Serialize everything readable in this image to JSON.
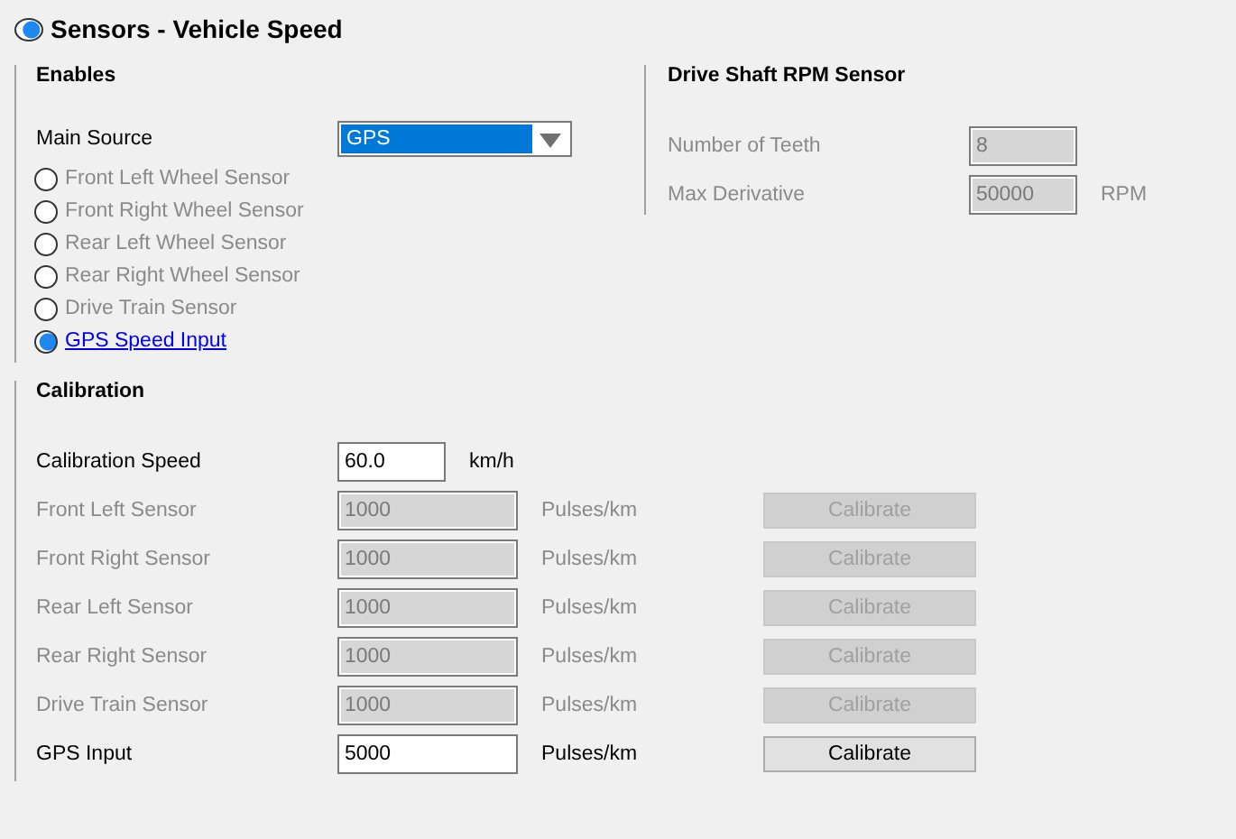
{
  "header": {
    "title": "Sensors - Vehicle Speed",
    "on": true
  },
  "enables": {
    "title": "Enables",
    "main_source": {
      "label": "Main Source",
      "value": "GPS"
    },
    "sources": [
      {
        "label": "Front Left Wheel Sensor",
        "selected": false,
        "disabled": true
      },
      {
        "label": "Front Right Wheel Sensor",
        "selected": false,
        "disabled": true
      },
      {
        "label": "Rear Left Wheel Sensor",
        "selected": false,
        "disabled": true
      },
      {
        "label": "Rear Right Wheel Sensor",
        "selected": false,
        "disabled": true
      },
      {
        "label": "Drive Train Sensor",
        "selected": false,
        "disabled": true
      },
      {
        "label": "GPS Speed Input",
        "selected": true,
        "disabled": false
      }
    ]
  },
  "drive_shaft": {
    "title": "Drive Shaft RPM Sensor",
    "fields": [
      {
        "label": "Number of Teeth",
        "value": "8",
        "disabled": true
      },
      {
        "label": "Max Derivative",
        "value": "50000",
        "unit": "RPM",
        "disabled": true
      }
    ]
  },
  "calibration": {
    "title": "Calibration",
    "speed": {
      "label": "Calibration Speed",
      "value": "60.0",
      "unit": "km/h"
    },
    "rows": [
      {
        "label": "Front Left Sensor",
        "value": "1000",
        "unit": "Pulses/km",
        "button": "Calibrate",
        "disabled": true
      },
      {
        "label": "Front Right Sensor",
        "value": "1000",
        "unit": "Pulses/km",
        "button": "Calibrate",
        "disabled": true
      },
      {
        "label": "Rear Left Sensor",
        "value": "1000",
        "unit": "Pulses/km",
        "button": "Calibrate",
        "disabled": true
      },
      {
        "label": "Rear Right Sensor",
        "value": "1000",
        "unit": "Pulses/km",
        "button": "Calibrate",
        "disabled": true
      },
      {
        "label": "Drive Train Sensor",
        "value": "1000",
        "unit": "Pulses/km",
        "button": "Calibrate",
        "disabled": true
      },
      {
        "label": "GPS Input",
        "value": "5000",
        "unit": "Pulses/km",
        "button": "Calibrate",
        "disabled": false
      }
    ]
  }
}
